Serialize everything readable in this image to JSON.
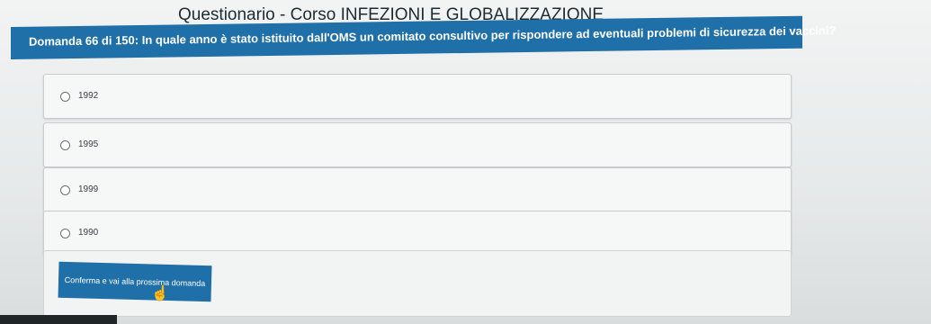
{
  "header": {
    "title": "Questionario - Corso INFEZIONI E GLOBALIZZAZIONE"
  },
  "question": {
    "text": "Domanda 66 di 150: In quale anno è stato istituito dall'OMS un comitato consultivo per rispondere ad eventuali problemi di sicurezza dei vaccini?"
  },
  "options": [
    {
      "label": "1992"
    },
    {
      "label": "1995"
    },
    {
      "label": "1999"
    },
    {
      "label": "1990"
    }
  ],
  "submit": {
    "label": "Conferma e vai alla prossima domanda"
  },
  "colors": {
    "accent": "#1f6fa8"
  },
  "icons": {
    "cursor": "hand-pointer-icon"
  }
}
